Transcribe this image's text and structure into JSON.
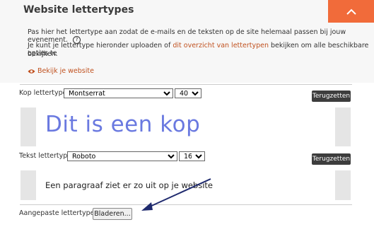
{
  "header": {
    "title": "Website lettertypes",
    "collapse_icon": "chevron-up-icon"
  },
  "info": {
    "line1": "Pas hier het lettertype aan zodat de e-mails en de teksten op de site helemaal passen bij jouw evenement.",
    "line2_before": "Je kunt je lettertype hieronder uploaden of ",
    "line2_link": "dit overzicht van lettertypen",
    "line2_after": " bekijken om alle beschikbare opties te",
    "line3": "bekijken.",
    "view_website": "Bekijk je website"
  },
  "heading_font": {
    "label": "Kop lettertype:",
    "font": "Montserrat",
    "size": "40",
    "reset": "Terugzetten",
    "preview": "Dit is een kop"
  },
  "text_font": {
    "label": "Tekst lettertype:",
    "font": "Roboto",
    "size": "16",
    "reset": "Terugzetten",
    "preview": "Een paragraaf ziet er zo uit op je website"
  },
  "custom_fonts": {
    "label": "Aangepaste lettertypen:",
    "browse": "Bladeren..."
  },
  "colors": {
    "accent": "#f16b3a",
    "heading_preview": "#6a79e0",
    "link": "#c0511f",
    "arrow": "#1f2a6e"
  }
}
